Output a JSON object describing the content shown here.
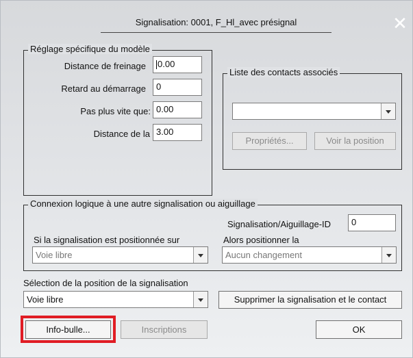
{
  "dialog": {
    "title": "Signalisation: 0001, F_Hl_avec présignal",
    "close_glyph": "✕"
  },
  "reglage": {
    "legend": "Réglage spécifique du modèle",
    "fields": [
      {
        "label": "Distance de freinage",
        "value": "0.00"
      },
      {
        "label": "Retard au démarrage",
        "value": "0"
      },
      {
        "label": "Pas plus vite que:",
        "value": "0.00"
      },
      {
        "label": "Distance de la",
        "value": "3.00"
      }
    ]
  },
  "contacts": {
    "legend": "Liste des contacts associés",
    "combo_value": "",
    "btn_proprietes": "Propriétés...",
    "btn_voir": "Voir la position"
  },
  "connexion": {
    "legend": "Connexion logique à une autre signalisation ou aiguillage",
    "id_label": "Signalisation/Aiguillage-ID",
    "id_value": "0",
    "si_label": "Si la signalisation est positionnée sur",
    "si_value": "Voie libre",
    "alors_label": "Alors positionner la",
    "alors_value": "Aucun changement"
  },
  "selection": {
    "label": "Sélection de la position de la signalisation",
    "value": "Voie libre",
    "btn_supprimer": "Supprimer la signalisation et le contact"
  },
  "footer": {
    "btn_info": "Info-bulle...",
    "btn_inscriptions": "Inscriptions",
    "btn_ok": "OK"
  },
  "colors": {
    "highlight": "#e01c24"
  }
}
